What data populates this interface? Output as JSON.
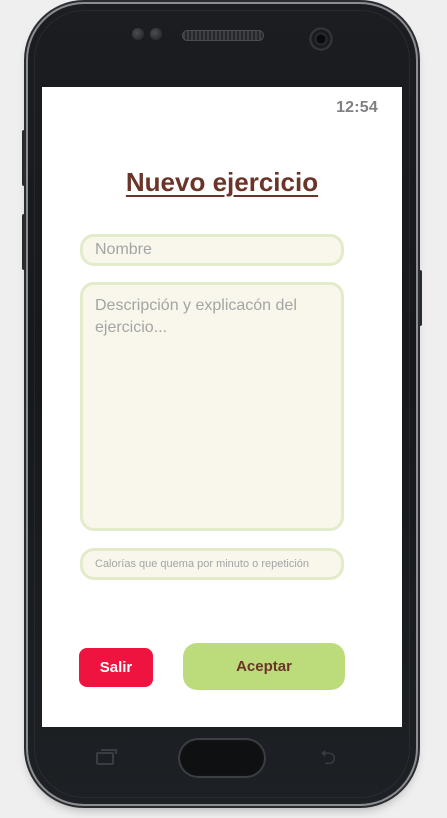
{
  "status_bar": {
    "time": "12:54"
  },
  "page": {
    "title": "Nuevo ejercicio"
  },
  "form": {
    "name_placeholder": "Nombre",
    "name_value": "",
    "description_placeholder": "Descripción y explicacón del ejercicio...",
    "description_value": "",
    "calories_placeholder": "Calorías que quema por minuto o repetición",
    "calories_value": ""
  },
  "actions": {
    "exit_label": "Salir",
    "accept_label": "Aceptar"
  },
  "colors": {
    "title": "#6b3428",
    "field_bg": "#f9f7ec",
    "field_border": "#e2ecca",
    "exit_button": "#ef1440",
    "accept_button": "#bcdb7a"
  },
  "device_icons": [
    "recent-apps-icon",
    "home-button",
    "back-icon"
  ]
}
